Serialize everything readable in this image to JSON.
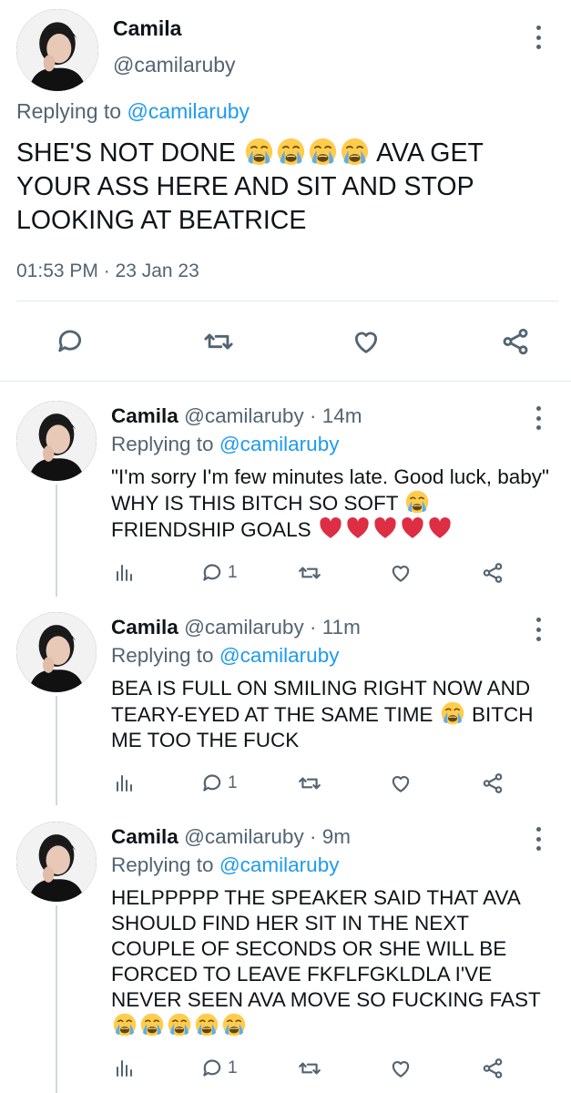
{
  "main_tweet": {
    "name": "Camila",
    "handle": "@camilaruby",
    "replying_prefix": "Replying to ",
    "replying_to": "@camilaruby",
    "text_a": "SHE'S NOT DONE",
    "emoji_a": "loudly-crying-face x4",
    "text_b": "AVA GET YOUR ASS HERE AND SIT AND STOP LOOKING AT BEATRICE",
    "timestamp": "01:53 PM · 23 Jan 23"
  },
  "replies": [
    {
      "name": "Camila",
      "handle": "@camilaruby",
      "time": "· 14m",
      "replying_prefix": "Replying to ",
      "replying_to": "@camilaruby",
      "text_a": "\"I'm sorry I'm few minutes late. Good luck, baby\" WHY IS THIS BITCH SO SOFT",
      "emoji_a": "loudly-crying-face",
      "text_b": "FRIENDSHIP GOALS",
      "emoji_b": "red-heart x5",
      "reply_count": "1"
    },
    {
      "name": "Camila",
      "handle": "@camilaruby",
      "time": "· 11m",
      "replying_prefix": "Replying to ",
      "replying_to": "@camilaruby",
      "text_a": "BEA IS FULL ON SMILING RIGHT NOW AND TEARY-EYED AT THE SAME TIME",
      "emoji_a": "loudly-crying-face",
      "text_b": "BITCH ME TOO THE FUCK",
      "reply_count": "1"
    },
    {
      "name": "Camila",
      "handle": "@camilaruby",
      "time": "· 9m",
      "replying_prefix": "Replying to ",
      "replying_to": "@camilaruby",
      "text_a": "HELPPPPP THE SPEAKER SAID THAT AVA SHOULD FIND HER SIT IN THE NEXT COUPLE OF SECONDS OR SHE WILL BE FORCED TO LEAVE FKFLFGKLDLA I'VE NEVER SEEN AVA MOVE SO FUCKING FAST",
      "emoji_a": "loudly-crying-face x5",
      "reply_count": "1"
    }
  ],
  "icons": [
    "more-options-icon",
    "reply-icon",
    "retweet-icon",
    "like-icon",
    "share-icon",
    "analytics-icon"
  ],
  "colors": {
    "link": "#1d9bf0",
    "secondary_text": "#536471",
    "divider": "#e1e8ed",
    "heart_emoji": "#e0245e"
  }
}
